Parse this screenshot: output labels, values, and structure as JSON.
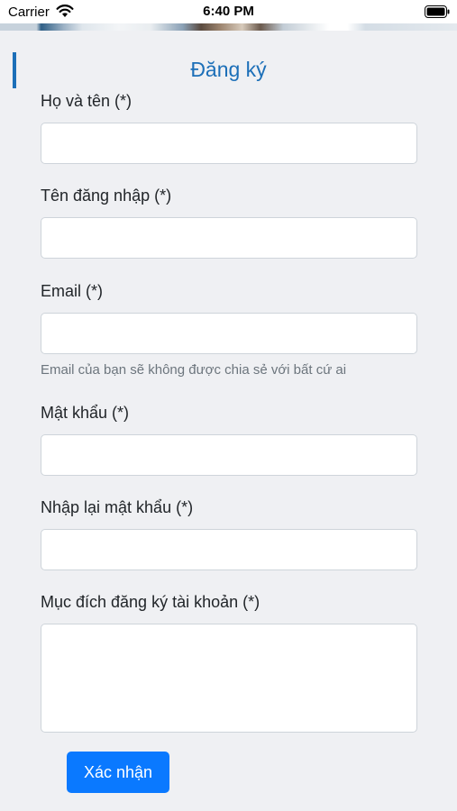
{
  "status_bar": {
    "carrier": "Carrier",
    "time": "6:40 PM",
    "wifi_icon": "wifi-icon",
    "battery_icon": "battery-icon"
  },
  "page": {
    "title": "Đăng ký",
    "accent_color": "#1c6fb8"
  },
  "form": {
    "full_name": {
      "label": "Họ và tên (*)",
      "value": ""
    },
    "username": {
      "label": "Tên đăng nhập (*)",
      "value": ""
    },
    "email": {
      "label": "Email (*)",
      "value": "",
      "help": "Email của bạn sẽ không được chia sẻ với bất cứ ai"
    },
    "password": {
      "label": "Mật khẩu (*)",
      "value": ""
    },
    "confirm_password": {
      "label": "Nhập lại mật khẩu (*)",
      "value": ""
    },
    "purpose": {
      "label": "Mục đích đăng ký tài khoản (*)",
      "value": ""
    },
    "submit_label": "Xác nhận",
    "submit_color": "#0a79ff"
  }
}
